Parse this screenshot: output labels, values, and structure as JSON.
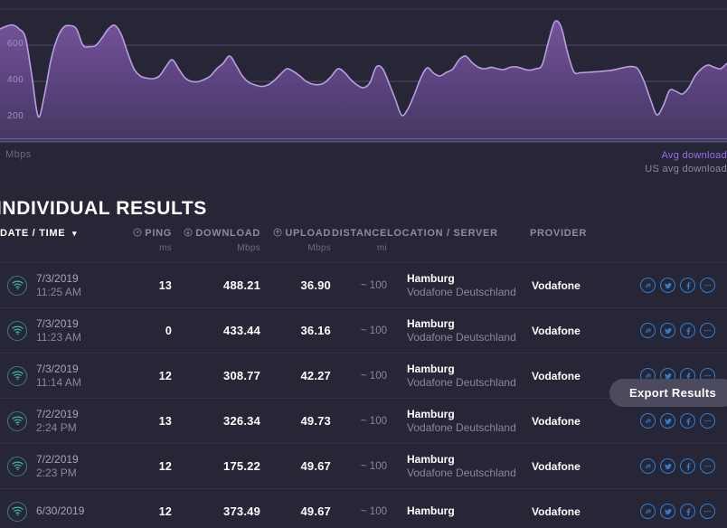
{
  "chart_data": {
    "type": "area",
    "title": "",
    "xlabel": "",
    "ylabel": "Mbps",
    "ylim": [
      0,
      800
    ],
    "yticks": [
      200,
      400,
      600
    ],
    "grid": true,
    "legend_position": "bottom-right",
    "series": [
      {
        "name": "Avg download",
        "color": "#9b6cf0",
        "values": [
          690,
          705,
          712,
          690,
          640,
          430,
          205,
          330,
          520,
          640,
          700,
          708,
          690,
          600,
          592,
          598,
          640,
          690,
          710,
          660,
          560,
          470,
          430,
          418,
          415,
          430,
          480,
          520,
          470,
          420,
          400,
          398,
          410,
          430,
          470,
          500,
          540,
          490,
          430,
          395,
          380,
          372,
          380,
          405,
          440,
          470,
          455,
          430,
          400,
          385,
          382,
          395,
          430,
          470,
          450,
          410,
          380,
          365,
          392,
          480,
          470,
          390,
          300,
          212,
          250,
          330,
          420,
          475,
          445,
          430,
          450,
          468,
          520,
          540,
          505,
          478,
          470,
          478,
          470,
          465,
          478,
          480,
          470,
          462,
          470,
          490,
          620,
          730,
          700,
          560,
          452,
          448,
          450,
          452,
          455,
          458,
          462,
          470,
          478,
          482,
          470,
          400,
          300,
          215,
          265,
          350,
          345,
          330,
          365,
          430,
          470,
          490,
          478,
          470,
          500
        ]
      },
      {
        "name": "US avg download",
        "color": "#8d89a4",
        "values": []
      }
    ]
  },
  "legend": {
    "avg_download": "Avg download",
    "us_avg_download": "US avg download"
  },
  "chart": {
    "unit_label": "Mbps",
    "y_ticks": [
      "600",
      "400",
      "200"
    ]
  },
  "results": {
    "title": "INDIVIDUAL RESULTS",
    "export_label": "Export Results",
    "columns": {
      "date": "DATE / TIME",
      "ping": "PING",
      "ping_unit": "ms",
      "download": "DOWNLOAD",
      "download_unit": "Mbps",
      "upload": "UPLOAD",
      "upload_unit": "Mbps",
      "distance": "DISTANCE",
      "distance_unit": "mi",
      "location": "LOCATION / SERVER",
      "provider": "PROVIDER"
    },
    "sort_indicator": "▾",
    "rows": [
      {
        "date": "7/3/2019",
        "time": "11:25 AM",
        "ping": "13",
        "download": "488.21",
        "upload": "36.90",
        "distance": "~ 100",
        "location": "Hamburg",
        "server": "Vodafone Deutschland",
        "provider": "Vodafone"
      },
      {
        "date": "7/3/2019",
        "time": "11:23 AM",
        "ping": "0",
        "download": "433.44",
        "upload": "36.16",
        "distance": "~ 100",
        "location": "Hamburg",
        "server": "Vodafone Deutschland",
        "provider": "Vodafone"
      },
      {
        "date": "7/3/2019",
        "time": "11:14 AM",
        "ping": "12",
        "download": "308.77",
        "upload": "42.27",
        "distance": "~ 100",
        "location": "Hamburg",
        "server": "Vodafone Deutschland",
        "provider": "Vodafone"
      },
      {
        "date": "7/2/2019",
        "time": "2:24 PM",
        "ping": "13",
        "download": "326.34",
        "upload": "49.73",
        "distance": "~ 100",
        "location": "Hamburg",
        "server": "Vodafone Deutschland",
        "provider": "Vodafone"
      },
      {
        "date": "7/2/2019",
        "time": "2:23 PM",
        "ping": "12",
        "download": "175.22",
        "upload": "49.67",
        "distance": "~ 100",
        "location": "Hamburg",
        "server": "Vodafone Deutschland",
        "provider": "Vodafone"
      },
      {
        "date": "6/30/2019",
        "time": "",
        "ping": "12",
        "download": "373.49",
        "upload": "49.67",
        "distance": "~ 100",
        "location": "Hamburg",
        "server": "",
        "provider": "Vodafone"
      }
    ],
    "action_icons": [
      "link-icon",
      "twitter-icon",
      "facebook-icon",
      "more-icon"
    ]
  },
  "colors": {
    "background": "#262636",
    "chart_line": "#b39ddb",
    "chart_fill": "#6b4b8a",
    "accent_purple": "#9b6cf0",
    "icon_blue": "#2e7fd4",
    "wifi_teal": "#3fb9ad"
  }
}
